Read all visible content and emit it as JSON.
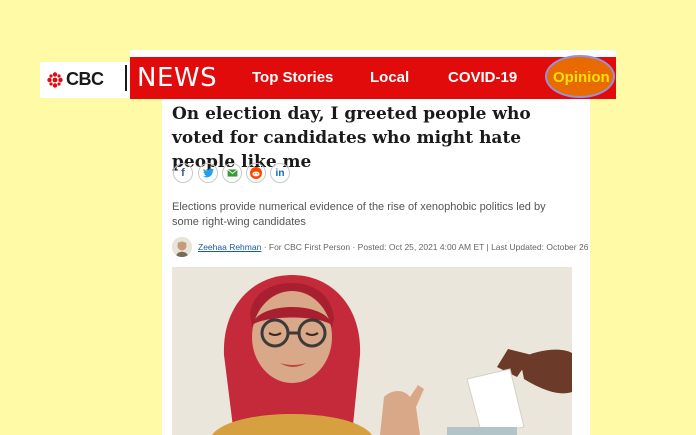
{
  "header": {
    "logo_text": "CBC",
    "section_title": "NEWS",
    "nav_items": [
      "Top Stories",
      "Local",
      "COVID-19"
    ],
    "highlighted_item": "Opinion",
    "colors": {
      "bar": "#e20b0b",
      "highlight": "#e86a00",
      "highlight_text": "#ffe100"
    }
  },
  "article": {
    "headline": "On election day, I greeted people who voted for candidates who might hate people like me",
    "share_icons": [
      "facebook-icon",
      "twitter-icon",
      "email-icon",
      "reddit-icon",
      "linkedin-icon"
    ],
    "deck": "Elections provide numerical evidence of the rise of xenophobic politics led by some right-wing candidates",
    "byline": {
      "author": "Zeehaa Rehman",
      "details": " · For CBC First Person · Posted: Oct 25, 2021 4:00 AM ET | Last Updated: October 26"
    }
  },
  "page": {
    "background": "#fffaa6"
  }
}
